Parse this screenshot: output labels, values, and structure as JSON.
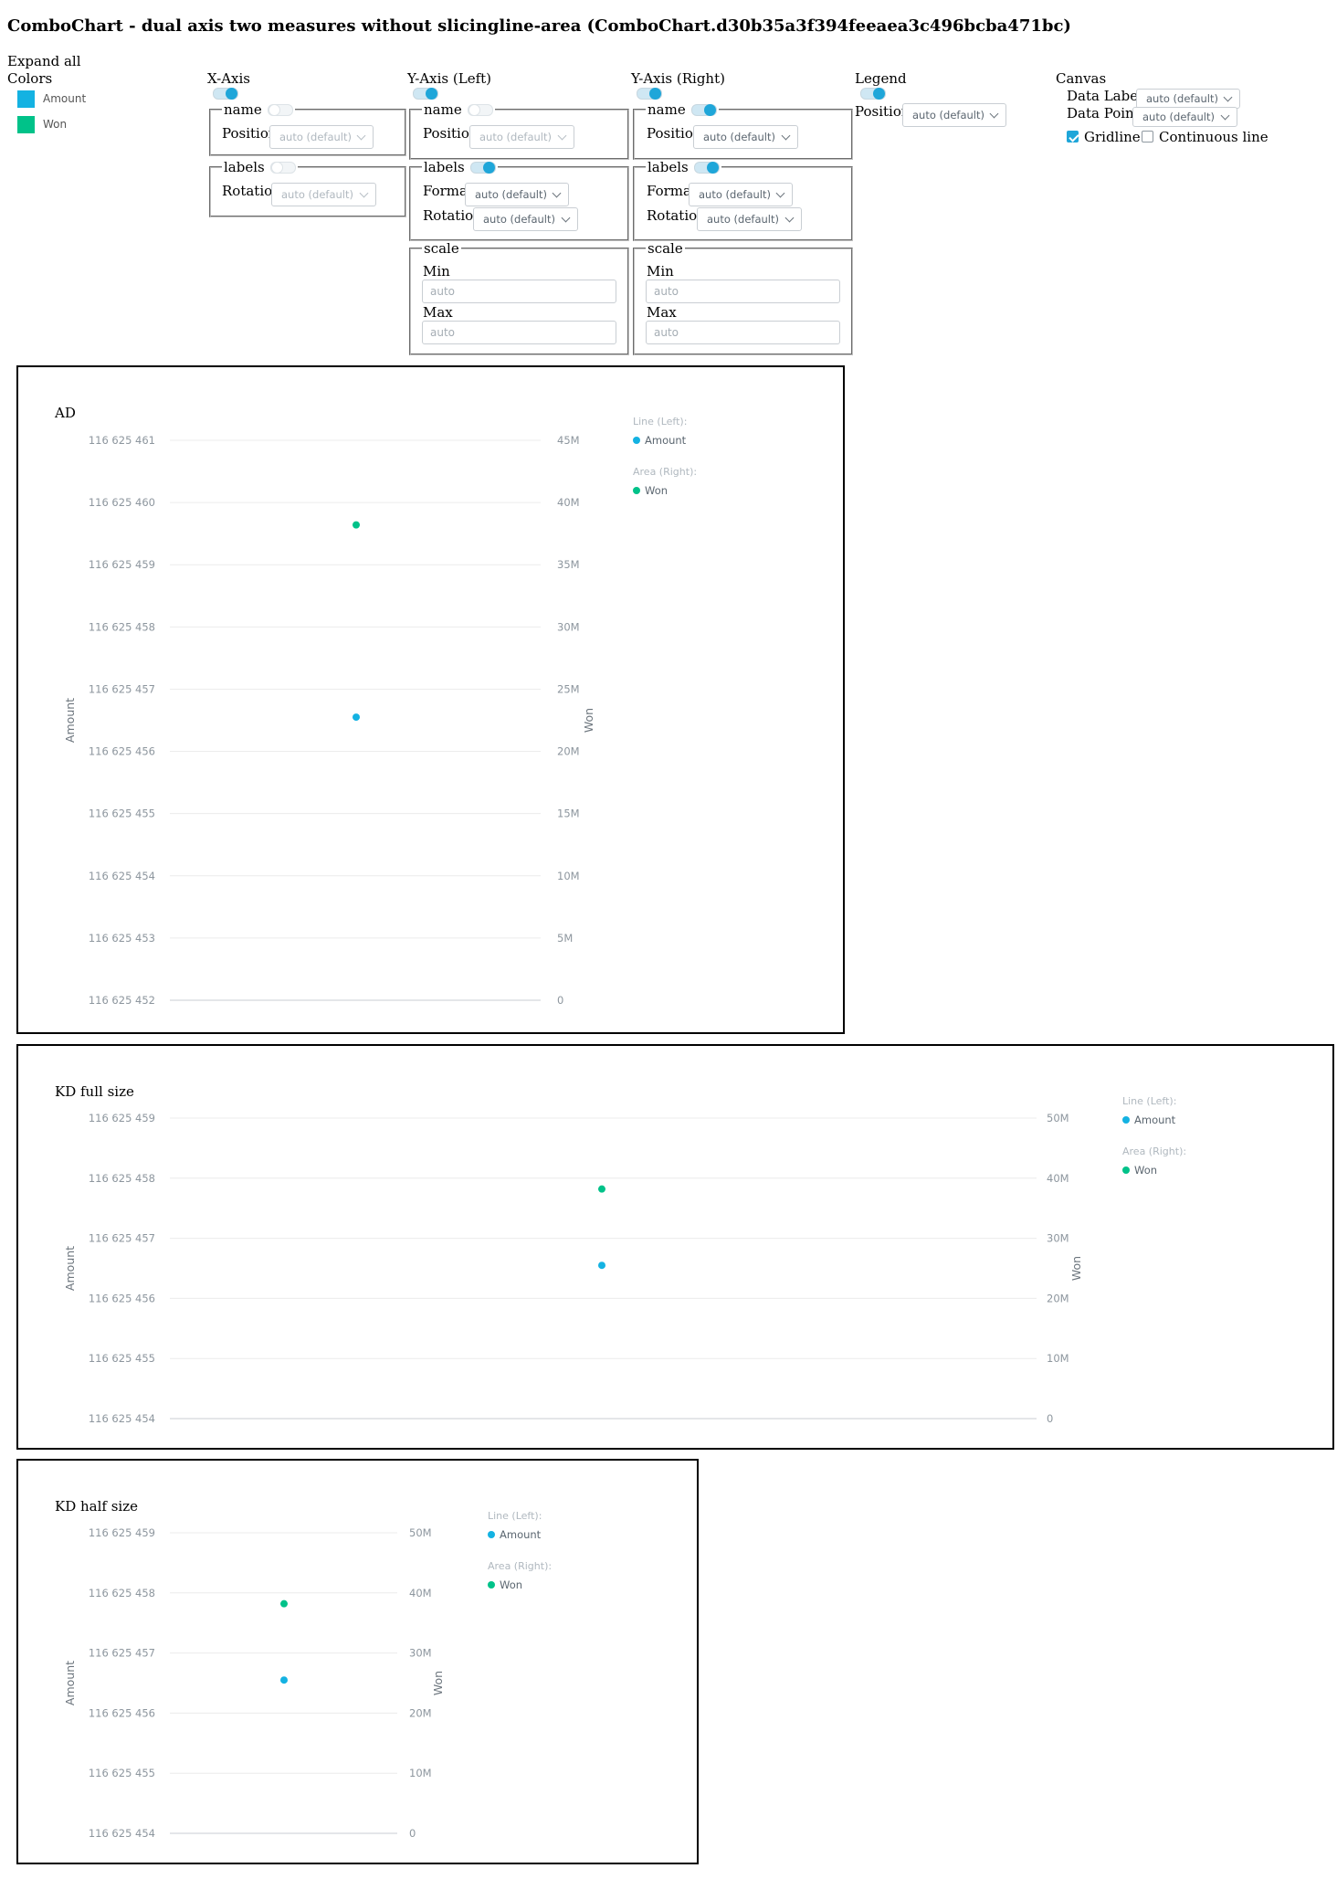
{
  "page": {
    "title": "ComboChart - dual axis two measures without slicingline-area (ComboChart.d30b35a3f394feeaea3c496bcba471bc)",
    "expand_all": "Expand all",
    "colors_label": "Colors"
  },
  "colors": [
    {
      "label": "Amount",
      "hex": "#14b2e2"
    },
    {
      "label": "Won",
      "hex": "#00c289"
    }
  ],
  "controls": {
    "x_axis": {
      "label": "X-Axis",
      "enabled": true,
      "name_group": {
        "legend": "name",
        "enabled": false,
        "position_label": "Position",
        "position_value": "auto (default)"
      },
      "labels_group": {
        "legend": "labels",
        "enabled": false,
        "rotation_label": "Rotation",
        "rotation_value": "auto (default)"
      }
    },
    "y_axis_left": {
      "label": "Y-Axis (Left)",
      "enabled": true,
      "name_group": {
        "legend": "name",
        "enabled": false,
        "position_label": "Position",
        "position_value": "auto (default)"
      },
      "labels_group": {
        "legend": "labels",
        "enabled": true,
        "format_label": "Format",
        "format_value": "auto (default)",
        "rotation_label": "Rotation",
        "rotation_value": "auto (default)"
      },
      "scale_group": {
        "legend": "scale",
        "min_label": "Min",
        "min_placeholder": "auto",
        "max_label": "Max",
        "max_placeholder": "auto"
      }
    },
    "y_axis_right": {
      "label": "Y-Axis (Right)",
      "enabled": true,
      "name_group": {
        "legend": "name",
        "enabled": true,
        "position_label": "Position",
        "position_value": "auto (default)"
      },
      "labels_group": {
        "legend": "labels",
        "enabled": true,
        "format_label": "Format",
        "format_value": "auto (default)",
        "rotation_label": "Rotation",
        "rotation_value": "auto (default)"
      },
      "scale_group": {
        "legend": "scale",
        "min_label": "Min",
        "min_placeholder": "auto",
        "max_label": "Max",
        "max_placeholder": "auto"
      }
    },
    "legend": {
      "label": "Legend",
      "enabled": true,
      "position_label": "Position",
      "position_value": "auto (default)"
    },
    "canvas": {
      "label": "Canvas",
      "data_labels_label": "Data Labels",
      "data_labels_value": "auto (default)",
      "data_points_label": "Data Points",
      "data_points_value": "auto (default)",
      "gridline_label": "Gridline",
      "gridline_checked": true,
      "continuous_line_label": "Continuous line",
      "continuous_line_checked": false
    }
  },
  "chart_data": [
    {
      "title": "AD",
      "type": "line",
      "left_axis": {
        "label": "Amount",
        "ticks": [
          "116 625 452",
          "116 625 453",
          "116 625 454",
          "116 625 455",
          "116 625 456",
          "116 625 457",
          "116 625 458",
          "116 625 459",
          "116 625 460",
          "116 625 461"
        ],
        "range": [
          116625452,
          116625461
        ]
      },
      "right_axis": {
        "label": "Won",
        "ticks": [
          "0",
          "5M",
          "10M",
          "15M",
          "20M",
          "25M",
          "30M",
          "35M",
          "40M",
          "45M"
        ],
        "range": [
          0,
          45000000
        ]
      },
      "legend": {
        "line_heading": "Line (Left):",
        "line_item": "Amount",
        "area_heading": "Area (Right):",
        "area_item": "Won"
      },
      "series": [
        {
          "name": "Amount",
          "axis": "left",
          "type": "line",
          "color": "#14b2e2",
          "values": [
            116625456.55
          ]
        },
        {
          "name": "Won",
          "axis": "right",
          "type": "area",
          "color": "#00c289",
          "values": [
            38200000
          ]
        }
      ],
      "grid": true
    },
    {
      "title": "KD full size",
      "type": "line",
      "left_axis": {
        "label": "Amount",
        "ticks": [
          "116 625 454",
          "116 625 455",
          "116 625 456",
          "116 625 457",
          "116 625 458",
          "116 625 459"
        ],
        "range": [
          116625454,
          116625459
        ]
      },
      "right_axis": {
        "label": "Won",
        "ticks": [
          "0",
          "10M",
          "20M",
          "30M",
          "40M",
          "50M"
        ],
        "range": [
          0,
          50000000
        ]
      },
      "legend": {
        "line_heading": "Line (Left):",
        "line_item": "Amount",
        "area_heading": "Area (Right):",
        "area_item": "Won"
      },
      "series": [
        {
          "name": "Amount",
          "axis": "left",
          "type": "line",
          "color": "#14b2e2",
          "values": [
            116625456.55
          ]
        },
        {
          "name": "Won",
          "axis": "right",
          "type": "area",
          "color": "#00c289",
          "values": [
            38200000
          ]
        }
      ],
      "grid": true
    },
    {
      "title": "KD half size",
      "type": "line",
      "left_axis": {
        "label": "Amount",
        "ticks": [
          "116 625 454",
          "116 625 455",
          "116 625 456",
          "116 625 457",
          "116 625 458",
          "116 625 459"
        ],
        "range": [
          116625454,
          116625459
        ]
      },
      "right_axis": {
        "label": "Won",
        "ticks": [
          "0",
          "10M",
          "20M",
          "30M",
          "40M",
          "50M"
        ],
        "range": [
          0,
          50000000
        ]
      },
      "legend": {
        "line_heading": "Line (Left):",
        "line_item": "Amount",
        "area_heading": "Area (Right):",
        "area_item": "Won"
      },
      "series": [
        {
          "name": "Amount",
          "axis": "left",
          "type": "line",
          "color": "#14b2e2",
          "values": [
            116625456.55
          ]
        },
        {
          "name": "Won",
          "axis": "right",
          "type": "area",
          "color": "#00c289",
          "values": [
            38200000
          ]
        }
      ],
      "grid": true
    }
  ]
}
